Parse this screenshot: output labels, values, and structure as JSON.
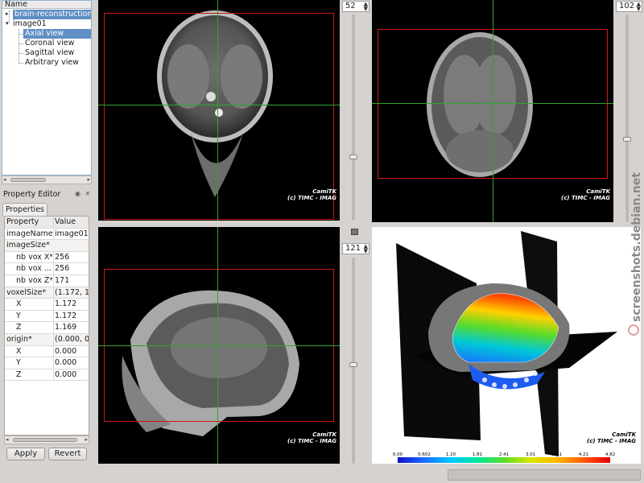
{
  "tree": {
    "header": "Name",
    "items": [
      {
        "label": "brain-reconstruction-",
        "selected": true
      },
      {
        "label": "image01",
        "selected": false
      },
      {
        "label": "Axial view",
        "selected": true
      },
      {
        "label": "Coronal view",
        "selected": false
      },
      {
        "label": "Sagittal view",
        "selected": false
      },
      {
        "label": "Arbitrary view",
        "selected": false
      }
    ]
  },
  "property_editor": {
    "title": "Property Editor",
    "tab": "Properties",
    "header": {
      "key": "Property",
      "value": "Value"
    },
    "rows": [
      {
        "key": "imageName",
        "value": "image01"
      },
      {
        "key": "imageSize*",
        "value": ""
      },
      {
        "key": "nb vox X*",
        "value": "256"
      },
      {
        "key": "nb vox ...",
        "value": "256"
      },
      {
        "key": "nb vox Z*",
        "value": "171"
      },
      {
        "key": "voxelSize*",
        "value": "(1.172, 1."
      },
      {
        "key": "X",
        "value": "1.172"
      },
      {
        "key": "Y",
        "value": "1.172"
      },
      {
        "key": "Z",
        "value": "1.169"
      },
      {
        "key": "origin*",
        "value": "(0.000, 0."
      },
      {
        "key": "X",
        "value": "0.000"
      },
      {
        "key": "Y",
        "value": "0.000"
      },
      {
        "key": "Z",
        "value": "0.000"
      }
    ],
    "apply_label": "Apply",
    "revert_label": "Revert"
  },
  "spinboxes": {
    "axial": "52",
    "coronal": "102",
    "sagittal": "121"
  },
  "watermark": {
    "line1": "CamiTK",
    "line2": "(c) TIMC - IMAG"
  },
  "side_watermark": "screenshots.debian.net",
  "colorbar": {
    "ticks": [
      "0.00",
      "0.602",
      "1.20",
      "1.81",
      "2.41",
      "3.01",
      "3.61",
      "4.21",
      "4.82"
    ],
    "colors": [
      "#1010c8",
      "#1a6cff",
      "#00c8ff",
      "#00e69a",
      "#5adc28",
      "#d8e600",
      "#ffb400",
      "#ff5a00",
      "#e60000"
    ]
  }
}
